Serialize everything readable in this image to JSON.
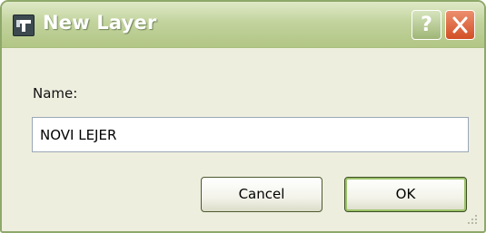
{
  "window": {
    "title": "New Layer",
    "app_icon": "app-icon",
    "help_glyph": "?",
    "close_icon": "close-icon"
  },
  "form": {
    "name_label": "Name:",
    "name_value": "NOVI LEJER"
  },
  "buttons": {
    "cancel_label": "Cancel",
    "ok_label": "OK"
  },
  "colors": {
    "titlebar": "#c2d39d",
    "dialog_bg": "#eeeedf",
    "close_button": "#d24f25",
    "ok_focus_ring": "#9dc36a"
  }
}
